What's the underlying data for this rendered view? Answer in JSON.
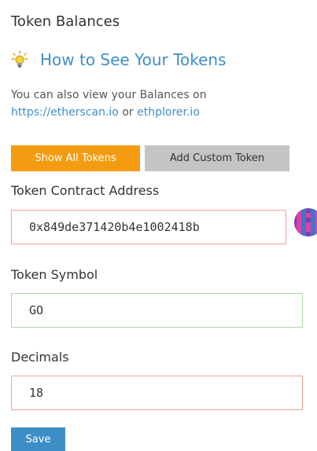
{
  "panel": {
    "title": "Token Balances",
    "how_to_link": "How to See Your Tokens",
    "description_prefix": "You can also view your Balances on",
    "etherscan_link": "https://etherscan.io",
    "or_text": " or ",
    "ethplorer_link": "ethplorer.io"
  },
  "buttons": {
    "show_all_tokens": "Show All Tokens",
    "add_custom_token": "Add Custom Token",
    "save": "Save"
  },
  "form": {
    "contract_address_label": "Token Contract Address",
    "contract_address_value": "0x849de371420b4e1002418b",
    "token_symbol_label": "Token Symbol",
    "token_symbol_value": "GO",
    "decimals_label": "Decimals",
    "decimals_value": "18"
  },
  "colors": {
    "accent_orange": "#f39c12",
    "link_blue": "#3f8ec9",
    "error_border": "#f4a29a",
    "valid_border": "#a8dca2",
    "save_blue": "#3d8ec6"
  },
  "icons": {
    "howto": "lightbulb-icon",
    "address": "identicon-icon"
  }
}
